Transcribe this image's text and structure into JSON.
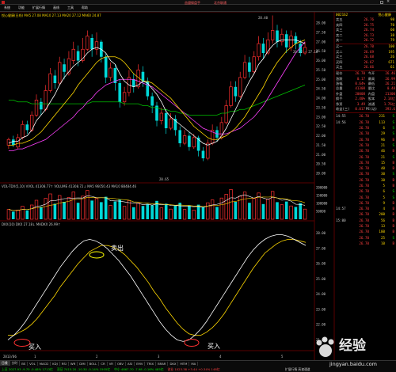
{
  "window": {
    "title_center": "益盟操盘手",
    "title_right": "北京联通"
  },
  "menu": [
    "系统",
    "功能",
    "扩展行情",
    "画线",
    "工具",
    "帮助"
  ],
  "stock": {
    "code": "002162",
    "name": "悦心健康",
    "header": "悦心健康(日线) MA5 27.08 MA10 27.13 MA20 27.12 MA60 24.87"
  },
  "price_axis": [
    "28.00",
    "27.50",
    "27.00",
    "26.50",
    "26.00",
    "25.50",
    "25.00",
    "24.50",
    "24.00",
    "23.50",
    "23.00",
    "22.50",
    "22.00",
    "21.50",
    "21.00",
    "20.50",
    "20.00"
  ],
  "annotations": {
    "high": "28.40",
    "low": "20.65",
    "last_label": "26.22 — 27.18"
  },
  "volume": {
    "header": "VOL-TDX(5,10) VVOL 41308.77↑ VOLUME 41308.72↓ MA5 96050.43 MA10 88484.46",
    "axis": [
      "200000",
      "150000",
      "100000",
      "50000"
    ]
  },
  "indicator": {
    "header": "DKX(10) DKX 27.18↓ MADKX 26.99↑",
    "axis": [
      "28.00",
      "27.00",
      "26.00",
      "25.00",
      "24.00",
      "23.00",
      "22.00",
      "21.00"
    ],
    "sell_label": "卖出",
    "buy_label": "买入"
  },
  "chart_data": {
    "type": "candlestick",
    "candles": [
      [
        21.5,
        21.8,
        21.3,
        21.9
      ],
      [
        21.8,
        21.5,
        21.4,
        22.0
      ],
      [
        21.4,
        21.9,
        21.3,
        22.1
      ],
      [
        21.9,
        22.6,
        21.8,
        22.8
      ],
      [
        22.6,
        22.3,
        22.1,
        22.8
      ],
      [
        22.3,
        23.1,
        22.2,
        23.3
      ],
      [
        23.1,
        23.9,
        23.0,
        24.2
      ],
      [
        23.8,
        23.4,
        23.1,
        24.0
      ],
      [
        23.4,
        24.4,
        23.3,
        24.7
      ],
      [
        24.4,
        25.3,
        24.3,
        25.6
      ],
      [
        25.2,
        24.8,
        24.5,
        25.5
      ],
      [
        24.8,
        25.9,
        24.7,
        26.2
      ],
      [
        25.8,
        25.4,
        25.0,
        26.1
      ],
      [
        25.3,
        26.1,
        25.2,
        26.5
      ],
      [
        26.0,
        26.6,
        25.8,
        27.0
      ],
      [
        26.5,
        26.0,
        25.7,
        26.8
      ],
      [
        26.0,
        26.6,
        25.9,
        27.2
      ],
      [
        26.6,
        27.3,
        26.5,
        27.6
      ],
      [
        27.2,
        26.6,
        26.2,
        27.4
      ],
      [
        26.6,
        27.0,
        26.3,
        27.5
      ],
      [
        27.0,
        26.2,
        25.9,
        27.1
      ],
      [
        26.2,
        25.1,
        24.8,
        26.4
      ],
      [
        25.1,
        25.6,
        24.9,
        25.9
      ],
      [
        25.6,
        24.8,
        24.4,
        25.8
      ],
      [
        24.8,
        23.8,
        23.5,
        25.0
      ],
      [
        23.8,
        24.3,
        23.6,
        24.6
      ],
      [
        24.3,
        25.1,
        24.1,
        25.5
      ],
      [
        25.0,
        24.6,
        24.3,
        25.3
      ],
      [
        24.6,
        25.5,
        24.5,
        25.8
      ],
      [
        25.4,
        24.9,
        24.6,
        25.7
      ],
      [
        24.9,
        24.1,
        23.9,
        25.1
      ],
      [
        24.1,
        23.6,
        23.2,
        24.3
      ],
      [
        23.6,
        22.8,
        22.5,
        23.8
      ],
      [
        22.8,
        23.2,
        22.6,
        23.5
      ],
      [
        23.2,
        22.4,
        22.1,
        23.4
      ],
      [
        22.4,
        22.9,
        22.3,
        23.2
      ],
      [
        22.9,
        22.3,
        22.0,
        23.1
      ],
      [
        22.3,
        21.6,
        21.4,
        22.5
      ],
      [
        21.6,
        22.0,
        21.5,
        22.3
      ],
      [
        22.0,
        21.4,
        21.2,
        22.2
      ],
      [
        21.4,
        21.9,
        21.3,
        22.1
      ],
      [
        21.9,
        21.2,
        20.9,
        22.0
      ],
      [
        21.2,
        20.8,
        20.65,
        21.4
      ],
      [
        20.8,
        21.6,
        20.7,
        21.8
      ],
      [
        21.6,
        22.3,
        21.5,
        22.6
      ],
      [
        22.3,
        21.9,
        21.7,
        22.5
      ],
      [
        21.9,
        22.7,
        21.8,
        23.0
      ],
      [
        22.7,
        23.6,
        22.6,
        23.9
      ],
      [
        23.6,
        24.6,
        23.5,
        24.9
      ],
      [
        24.6,
        24.1,
        23.8,
        24.9
      ],
      [
        24.1,
        25.1,
        24.0,
        25.4
      ],
      [
        25.1,
        25.9,
        25.0,
        26.3
      ],
      [
        25.9,
        25.4,
        25.1,
        26.2
      ],
      [
        25.4,
        26.2,
        25.3,
        26.5
      ],
      [
        26.2,
        26.9,
        26.0,
        27.3
      ],
      [
        26.9,
        26.4,
        26.1,
        27.2
      ],
      [
        26.4,
        27.1,
        26.3,
        27.5
      ],
      [
        27.1,
        27.6,
        26.9,
        28.4
      ],
      [
        27.6,
        27.0,
        26.7,
        27.9
      ],
      [
        27.0,
        27.4,
        26.8,
        27.7
      ],
      [
        27.4,
        26.7,
        26.4,
        27.6
      ],
      [
        26.7,
        27.3,
        26.5,
        27.6
      ],
      [
        27.3,
        26.9,
        26.6,
        27.5
      ],
      [
        26.9,
        26.4,
        26.22,
        27.1
      ],
      [
        26.4,
        26.7,
        26.3,
        27.0
      ]
    ],
    "ma5": [
      21.6,
      21.7,
      21.7,
      21.9,
      22.0,
      22.3,
      22.8,
      23.1,
      23.4,
      23.8,
      24.2,
      24.7,
      25.1,
      25.4,
      25.7,
      25.9,
      26.1,
      26.4,
      26.6,
      26.7,
      26.6,
      26.4,
      26.0,
      25.8,
      25.3,
      24.9,
      24.7,
      24.6,
      24.7,
      24.9,
      24.8,
      24.5,
      24.2,
      23.8,
      23.3,
      23.0,
      22.8,
      22.6,
      22.4,
      22.2,
      22.0,
      21.8,
      21.6,
      21.5,
      21.6,
      21.7,
      22.0,
      22.4,
      22.9,
      23.4,
      23.9,
      24.4,
      24.9,
      25.3,
      25.8,
      26.1,
      26.5,
      26.8,
      27.0,
      27.1,
      27.1,
      27.1,
      27.1,
      27.0,
      26.9
    ],
    "ma10": [
      21.5,
      21.5,
      21.6,
      21.6,
      21.7,
      21.8,
      22.0,
      22.2,
      22.5,
      22.8,
      23.1,
      23.4,
      23.7,
      24.0,
      24.3,
      24.7,
      25.0,
      25.3,
      25.6,
      25.9,
      26.1,
      26.2,
      26.2,
      26.2,
      26.1,
      25.9,
      25.6,
      25.3,
      25.1,
      24.9,
      24.9,
      24.8,
      24.6,
      24.4,
      24.2,
      24.0,
      23.7,
      23.4,
      23.1,
      22.8,
      22.5,
      22.3,
      22.1,
      21.9,
      21.8,
      21.8,
      21.9,
      22.0,
      22.2,
      22.4,
      22.7,
      23.0,
      23.4,
      23.8,
      24.2,
      24.6,
      25.1,
      25.5,
      25.9,
      26.2,
      26.5,
      26.7,
      26.9,
      27.0,
      27.1
    ],
    "ma20": [
      21.2,
      21.2,
      21.3,
      21.3,
      21.4,
      21.5,
      21.6,
      21.7,
      21.8,
      22.0,
      22.2,
      22.4,
      22.6,
      22.8,
      23.0,
      23.3,
      23.5,
      23.8,
      24.0,
      24.3,
      24.5,
      24.7,
      24.8,
      24.9,
      25.0,
      25.0,
      25.0,
      25.0,
      24.9,
      24.8,
      24.7,
      24.6,
      24.4,
      24.2,
      24.0,
      23.8,
      23.6,
      23.4,
      23.2,
      23.0,
      22.8,
      22.6,
      22.4,
      22.3,
      22.2,
      22.1,
      22.1,
      22.1,
      22.2,
      22.3,
      22.4,
      22.6,
      22.8,
      23.0,
      23.3,
      23.6,
      24.0,
      24.4,
      24.8,
      25.2,
      25.6,
      26.0,
      26.4,
      26.7,
      27.0
    ],
    "ma60": [
      23.9,
      23.9,
      23.8,
      23.8,
      23.8,
      23.7,
      23.7,
      23.7,
      23.7,
      23.7,
      23.7,
      23.7,
      23.7,
      23.7,
      23.7,
      23.7,
      23.7,
      23.7,
      23.8,
      23.8,
      23.8,
      23.8,
      23.8,
      23.8,
      23.8,
      23.7,
      23.7,
      23.7,
      23.7,
      23.6,
      23.6,
      23.5,
      23.5,
      23.4,
      23.4,
      23.3,
      23.3,
      23.2,
      23.2,
      23.1,
      23.1,
      23.1,
      23.1,
      23.1,
      23.1,
      23.1,
      23.2,
      23.2,
      23.3,
      23.3,
      23.4,
      23.4,
      23.5,
      23.6,
      23.7,
      23.8,
      23.9,
      24.0,
      24.1,
      24.2,
      24.3,
      24.4,
      24.5,
      24.6,
      24.7
    ],
    "volume": [
      62000,
      48000,
      58000,
      82000,
      56000,
      90000,
      120000,
      78000,
      132000,
      160000,
      98000,
      150000,
      110000,
      138000,
      172000,
      104000,
      146000,
      182000,
      118000,
      130000,
      108000,
      142000,
      88000,
      112000,
      124000,
      82000,
      118000,
      76000,
      102000,
      84000,
      96000,
      88000,
      116000,
      72000,
      98000,
      64000,
      86000,
      104000,
      62000,
      88000,
      58000,
      92000,
      76000,
      104000,
      122000,
      78000,
      134000,
      158000,
      188000,
      110000,
      146000,
      172000,
      104000,
      132000,
      166000,
      96000,
      128000,
      176000,
      108000,
      92000,
      112000,
      84000,
      78000,
      102000,
      64000
    ],
    "dkx": [
      21.0,
      21.3,
      21.7,
      22.2,
      22.8,
      23.4,
      24.0,
      24.6,
      25.2,
      25.8,
      26.3,
      26.8,
      27.2,
      27.5,
      27.6,
      27.5,
      27.3,
      27.0,
      26.6,
      26.2,
      25.7,
      25.2,
      24.6,
      24.0,
      23.4,
      22.8,
      22.2,
      21.7,
      21.3,
      21.0,
      20.9,
      21.0,
      21.3,
      21.7,
      22.2,
      22.8,
      23.4,
      24.0,
      24.6,
      25.2,
      25.8,
      26.4,
      26.9,
      27.3,
      27.6,
      27.8,
      27.9,
      27.9,
      27.8,
      27.6,
      27.4,
      27.2
    ],
    "madkx": [
      21.3,
      21.3,
      21.5,
      21.7,
      22.0,
      22.4,
      22.9,
      23.4,
      23.9,
      24.5,
      25.0,
      25.5,
      26.0,
      26.4,
      26.8,
      27.0,
      27.2,
      27.2,
      27.1,
      26.9,
      26.6,
      26.2,
      25.8,
      25.3,
      24.8,
      24.2,
      23.7,
      23.1,
      22.6,
      22.1,
      21.7,
      21.4,
      21.3,
      21.3,
      21.5,
      21.8,
      22.2,
      22.7,
      23.3,
      23.9,
      24.5,
      25.1,
      25.7,
      26.2,
      26.7,
      27.0,
      27.3,
      27.5,
      27.6,
      27.6,
      27.5,
      27.4
    ]
  },
  "quote": {
    "code": "002162",
    "name": "悦心健康",
    "sell": [
      {
        "label": "卖五",
        "price": "26.76",
        "vol": "98"
      },
      {
        "label": "卖四",
        "price": "26.75",
        "vol": "70"
      },
      {
        "label": "卖三",
        "price": "26.74",
        "vol": "60"
      },
      {
        "label": "卖二",
        "price": "26.73",
        "vol": "38"
      },
      {
        "label": "卖一",
        "price": "26.72",
        "vol": "79"
      }
    ],
    "buy": [
      {
        "label": "买一",
        "price": "26.70",
        "vol": "100"
      },
      {
        "label": "买二",
        "price": "26.69",
        "vol": "195"
      },
      {
        "label": "买三",
        "price": "26.68",
        "vol": "26"
      },
      {
        "label": "买四",
        "price": "26.67",
        "vol": "671"
      },
      {
        "label": "买五",
        "price": "26.66",
        "vol": "61"
      }
    ],
    "stats": [
      {
        "l1": "现价",
        "v1": "26.70",
        "l2": "今开",
        "v2": "26.46"
      },
      {
        "l1": "涨跌",
        "v1": "0.17",
        "l2": "最高",
        "v2": "26.99"
      },
      {
        "l1": "涨幅",
        "v1": "0.64%",
        "l2": "最低",
        "v2": "26.21"
      },
      {
        "l1": "总量",
        "v1": "41308",
        "l2": "量比",
        "v2": "0.48"
      },
      {
        "l1": "外盘",
        "v1": "20008",
        "l2": "内盘",
        "v2": "21300"
      },
      {
        "l1": "换手",
        "v1": "2.40%",
        "l2": "股本",
        "v2": "2.14亿"
      },
      {
        "l1": "净资",
        "v1": "3.49",
        "l2": "流通",
        "v2": "1.76亿"
      },
      {
        "l1": "收益(三)",
        "v1": "0.017",
        "l2": "PE(动)",
        "v2": "393.6"
      }
    ],
    "ticks": [
      {
        "t": "14:55",
        "p": "26.70",
        "v": "231",
        "d": "S"
      },
      {
        "t": "14:56",
        "p": "26.70",
        "v": "113",
        "d": "S"
      },
      {
        "t": "",
        "p": "26.70",
        "v": "6",
        "d": "S"
      },
      {
        "t": "",
        "p": "26.70",
        "v": "29",
        "d": "S"
      },
      {
        "t": "",
        "p": "26.70",
        "v": "96",
        "d": "B"
      },
      {
        "t": "",
        "p": "26.70",
        "v": "21",
        "d": "S"
      },
      {
        "t": "",
        "p": "26.70",
        "v": "46",
        "d": "B"
      },
      {
        "t": "",
        "p": "26.70",
        "v": "21",
        "d": "S"
      },
      {
        "t": "",
        "p": "26.70",
        "v": "15",
        "d": "B"
      },
      {
        "t": "",
        "p": "26.70",
        "v": "40",
        "d": "B"
      },
      {
        "t": "",
        "p": "26.70",
        "v": "30",
        "d": "S"
      },
      {
        "t": "",
        "p": "26.70",
        "v": "30",
        "d": "B"
      },
      {
        "t": "",
        "p": "26.70",
        "v": "5",
        "d": "B"
      },
      {
        "t": "",
        "p": "26.70",
        "v": "6",
        "d": "S"
      },
      {
        "t": "",
        "p": "26.70",
        "v": "5",
        "d": "S"
      },
      {
        "t": "",
        "p": "26.70",
        "v": "9",
        "d": "B"
      },
      {
        "t": "14:57",
        "p": "26.70",
        "v": "4",
        "d": "B"
      },
      {
        "t": "",
        "p": "26.70",
        "v": "200",
        "d": "B"
      },
      {
        "t": "15:00",
        "p": "26.70",
        "v": "56",
        "d": "B"
      },
      {
        "t": "",
        "p": "26.70",
        "v": "13",
        "d": "B"
      },
      {
        "t": "",
        "p": "26.70",
        "v": "100",
        "d": "B"
      },
      {
        "t": "",
        "p": "26.70",
        "v": "25",
        "d": "S"
      },
      {
        "t": "",
        "p": "26.70",
        "v": "10",
        "d": "B"
      },
      {
        "t": "",
        "p": "26.70",
        "v": "5",
        "d": "B"
      },
      {
        "t": "",
        "p": "26.70",
        "v": "27",
        "d": "B"
      },
      {
        "t": "",
        "p": "26.70",
        "v": "30",
        "d": "B"
      },
      {
        "t": "",
        "p": "26.70",
        "v": "40",
        "d": "B"
      },
      {
        "t": "",
        "p": "26.70",
        "v": "30",
        "d": "B"
      },
      {
        "t": "",
        "p": "26.70",
        "v": "11",
        "d": "S"
      },
      {
        "t": "",
        "p": "26.70",
        "v": "20",
        "d": "B"
      },
      {
        "t": "",
        "p": "26.70",
        "v": "10",
        "d": "S"
      },
      {
        "t": "",
        "p": "26.70",
        "v": "50",
        "d": "B"
      },
      {
        "t": "",
        "p": "26.70",
        "v": "30",
        "d": "S"
      }
    ]
  },
  "date_axis": [
    "2013/06",
    "1",
    "",
    "2",
    "",
    "3",
    "",
    "4",
    "",
    "5"
  ],
  "bottom_tabs": [
    "日线",
    "分时",
    "BS",
    "VOL",
    "MACD",
    "KDJ",
    "RSI",
    "WR",
    "DMI",
    "BOLL",
    "CR",
    "VR",
    "OBV",
    "ASI",
    "EMV",
    "TRIX",
    "BRAR",
    "DKX",
    "MTM",
    "MA"
  ],
  "status": [
    {
      "text": "上证 2027.93 -9.70 -0.48% 1713亿",
      "color": "#00e000"
    },
    {
      "text": "深证 7415.20 -10.30 -0.14% 1505亿",
      "color": "#00e000"
    },
    {
      "text": "中小 4867.70 -7.98 -0.16% 485亿",
      "color": "#00e000"
    },
    {
      "text": "创业 1023.38 +3.44 +0.34% 148亿",
      "color": "#ff4040"
    }
  ],
  "status_tip": "扩展行情  高速通道",
  "watermark": "经验",
  "watermark_url": "jingyan.baidu.com",
  "colors": {
    "up": "#ff3030",
    "down": "#00d8d8",
    "ma5": "#ffffff",
    "ma10": "#ffd800",
    "ma20": "#ff40ff",
    "ma60": "#00c000"
  }
}
